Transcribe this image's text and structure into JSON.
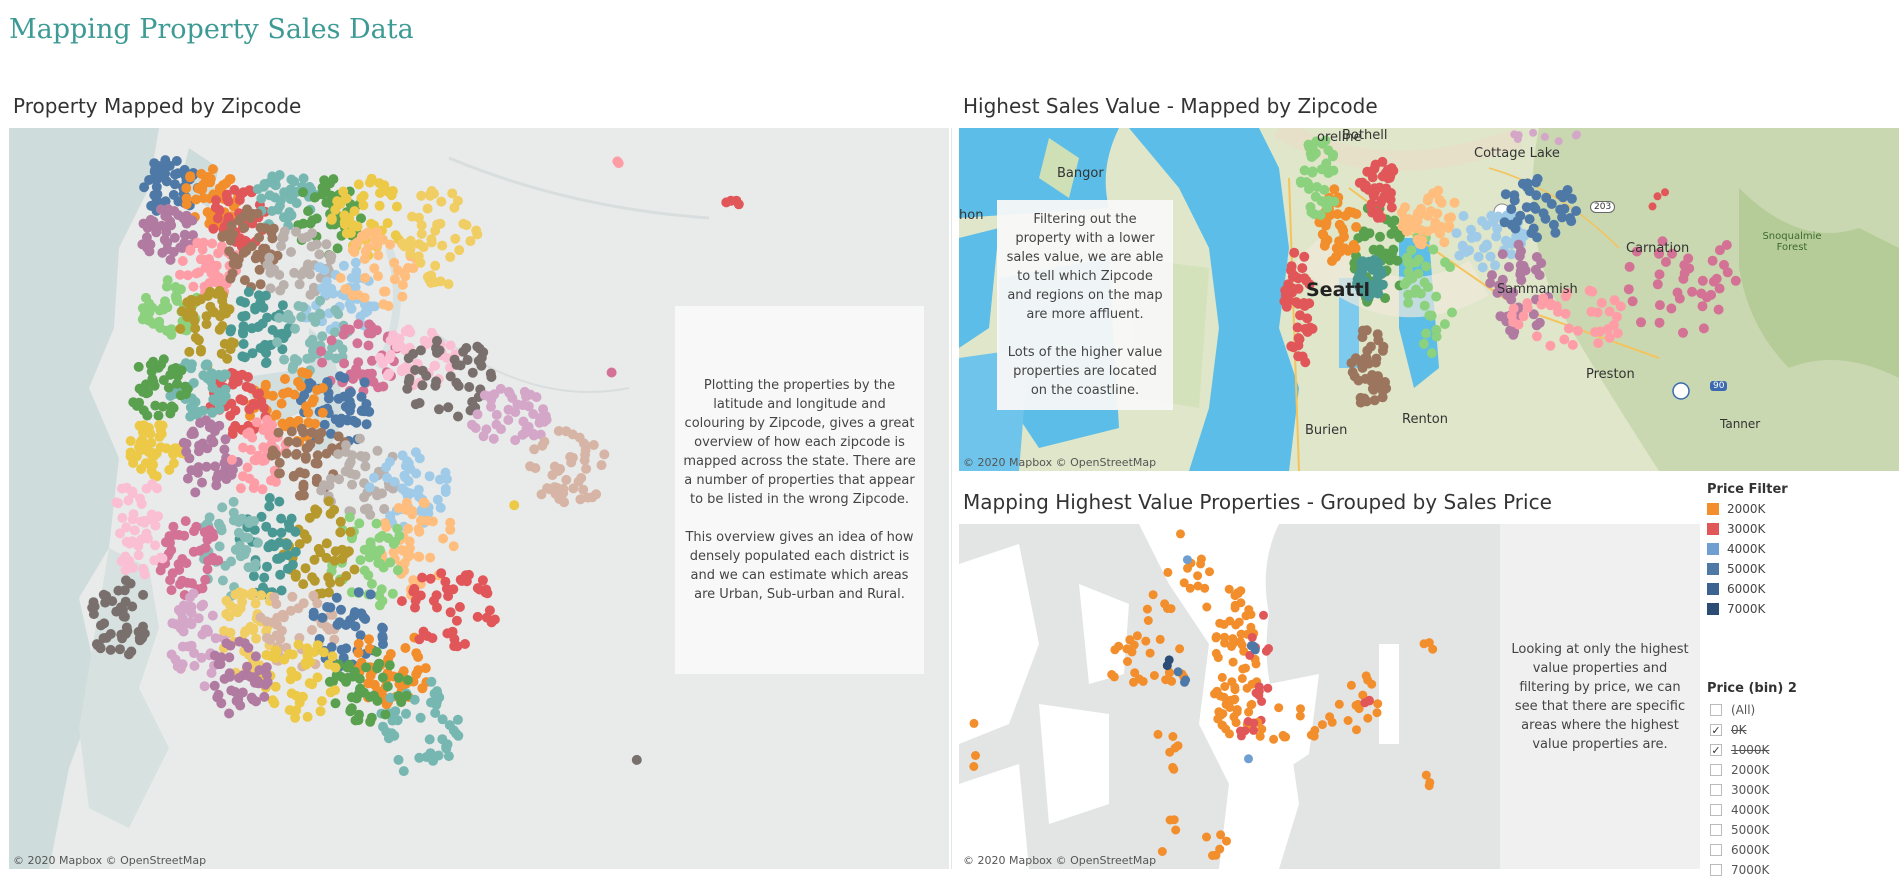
{
  "dashboard_title": "Mapping Property Sales Data",
  "panel_left": {
    "title": "Property Mapped by Zipcode",
    "note": "Plotting the properties by the latitude and longitude and colouring by Zipcode, gives a great overview of how each zipcode is mapped across the state. There are a number of properties that appear to be listed in the wrong Zipcode.\n\nThis overview gives an idea of how densely populated each district is and we can estimate which areas are Urban, Sub-urban and Rural.",
    "attribution": "© 2020 Mapbox  © OpenStreetMap"
  },
  "panel_top_right": {
    "title": "Highest Sales Value - Mapped by Zipcode",
    "note": "Filtering out the property with a lower sales value, we are able to tell which Zipcode and regions on the map are more affluent.\n\nLots of the higher value properties are located on the coastline.",
    "attribution": "© 2020 Mapbox  © OpenStreetMap",
    "places": [
      "Bothell",
      "Cottage Lake",
      "oreline",
      "Bangor",
      "hon",
      "Seattl",
      "Carnation",
      "Snoqualmie Forest",
      "Sammamish",
      "Preston",
      "Renton",
      "Burien",
      "Tanner"
    ],
    "shields": [
      "203",
      "90"
    ]
  },
  "panel_bottom_right": {
    "title": "Mapping Highest Value Properties - Grouped by Sales Price",
    "note": "Looking at only the highest value properties and filtering by price, we can see that there are specific areas where the highest value properties are.",
    "attribution": "© 2020 Mapbox  © OpenStreetMap"
  },
  "price_filter": {
    "title": "Price Filter",
    "items": [
      {
        "label": "2000K",
        "color": "#f28e2b"
      },
      {
        "label": "3000K",
        "color": "#e15759"
      },
      {
        "label": "4000K",
        "color": "#6f9fd0"
      },
      {
        "label": "5000K",
        "color": "#4e79a7"
      },
      {
        "label": "6000K",
        "color": "#3b6290"
      },
      {
        "label": "7000K",
        "color": "#2b4d75"
      }
    ]
  },
  "price_bin": {
    "title": "Price (bin) 2",
    "items": [
      {
        "label": "(All)",
        "checked": false,
        "struck": false
      },
      {
        "label": "0K",
        "checked": true,
        "struck": true
      },
      {
        "label": "1000K",
        "checked": true,
        "struck": true
      },
      {
        "label": "2000K",
        "checked": false,
        "struck": false
      },
      {
        "label": "3000K",
        "checked": false,
        "struck": false
      },
      {
        "label": "4000K",
        "checked": false,
        "struck": false
      },
      {
        "label": "5000K",
        "checked": false,
        "struck": false
      },
      {
        "label": "6000K",
        "checked": false,
        "struck": false
      },
      {
        "label": "7000K",
        "checked": false,
        "struck": false
      }
    ]
  },
  "colors": {
    "title": "#3d9a94",
    "water_left": "#cfdcdc",
    "land_left": "#e9ebea",
    "water_top": "#5bbde8",
    "land_top": "#dfe6c9",
    "land_bottom": "#e3e4e4"
  }
}
